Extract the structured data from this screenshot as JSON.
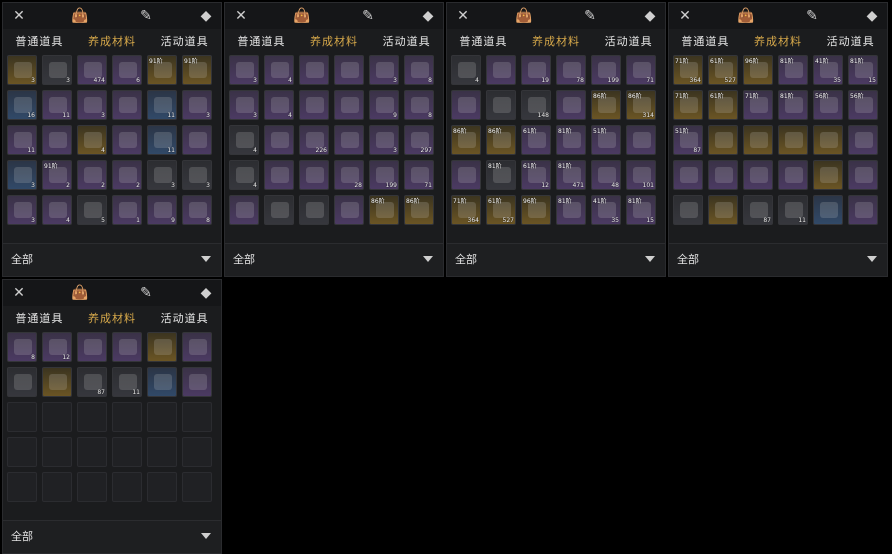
{
  "tabs": {
    "common": "普通道具",
    "materials": "养成材料",
    "event": "活动道具"
  },
  "filter": {
    "label": "全部"
  },
  "icons": {
    "swords": "crossed-swords-icon",
    "bag": "bag-icon",
    "scroll": "scroll-quill-icon",
    "gem": "gem-icon",
    "dropdown": "chevron-down-icon"
  },
  "panels": [
    {
      "cells": [
        {
          "q": "3",
          "r": "gold"
        },
        {
          "q": "3",
          "r": "gray"
        },
        {
          "q": "474",
          "r": "purple"
        },
        {
          "q": "6",
          "r": "purple"
        },
        {
          "lv": "91阶",
          "q": "",
          "r": "gold"
        },
        {
          "lv": "91阶",
          "q": "",
          "r": "gold"
        },
        {
          "q": "16",
          "r": "blue"
        },
        {
          "q": "11",
          "r": "purple"
        },
        {
          "q": "3",
          "r": "purple"
        },
        {
          "q": "",
          "r": "purple"
        },
        {
          "q": "11",
          "r": "blue"
        },
        {
          "q": "3",
          "r": "purple"
        },
        {
          "q": "11",
          "r": "purple"
        },
        {
          "q": "",
          "r": "purple"
        },
        {
          "q": "4",
          "r": "gold"
        },
        {
          "q": "",
          "r": "purple"
        },
        {
          "q": "11",
          "r": "blue"
        },
        {
          "q": "",
          "r": "purple"
        },
        {
          "q": "3",
          "r": "blue"
        },
        {
          "lv": "91阶",
          "q": "2",
          "r": "purple"
        },
        {
          "q": "2",
          "r": "purple"
        },
        {
          "q": "2",
          "r": "purple"
        },
        {
          "q": "3",
          "r": "gray"
        },
        {
          "q": "3",
          "r": "gray"
        },
        {
          "q": "3",
          "r": "purple"
        },
        {
          "q": "4",
          "r": "purple"
        },
        {
          "q": "5",
          "r": "gray"
        },
        {
          "q": "1",
          "r": "purple"
        },
        {
          "q": "9",
          "r": "purple"
        },
        {
          "q": "8",
          "r": "purple"
        }
      ]
    },
    {
      "cells": [
        {
          "q": "3",
          "r": "purple"
        },
        {
          "q": "4",
          "r": "purple"
        },
        {
          "q": "",
          "r": "purple"
        },
        {
          "q": "",
          "r": "purple"
        },
        {
          "q": "3",
          "r": "purple"
        },
        {
          "q": "8",
          "r": "purple"
        },
        {
          "q": "3",
          "r": "purple"
        },
        {
          "q": "4",
          "r": "purple"
        },
        {
          "q": "",
          "r": "purple"
        },
        {
          "q": "",
          "r": "purple"
        },
        {
          "q": "9",
          "r": "purple"
        },
        {
          "q": "8",
          "r": "purple"
        },
        {
          "q": "4",
          "r": "gray"
        },
        {
          "q": "",
          "r": "purple"
        },
        {
          "q": "226",
          "r": "purple"
        },
        {
          "q": "",
          "r": "purple"
        },
        {
          "q": "3",
          "r": "purple"
        },
        {
          "q": "297",
          "r": "purple"
        },
        {
          "q": "4",
          "r": "gray"
        },
        {
          "q": "",
          "r": "purple"
        },
        {
          "q": "",
          "r": "purple"
        },
        {
          "q": "28",
          "r": "purple"
        },
        {
          "q": "199",
          "r": "purple"
        },
        {
          "q": "71",
          "r": "purple"
        },
        {
          "q": "",
          "r": "purple"
        },
        {
          "q": "",
          "r": "gray"
        },
        {
          "q": "",
          "r": "gray"
        },
        {
          "q": "",
          "r": "purple"
        },
        {
          "lv": "86阶",
          "q": "",
          "r": "gold"
        },
        {
          "lv": "86阶",
          "q": "",
          "r": "gold"
        }
      ]
    },
    {
      "cells": [
        {
          "q": "4",
          "r": "gray"
        },
        {
          "q": "",
          "r": "purple"
        },
        {
          "q": "19",
          "r": "purple"
        },
        {
          "q": "78",
          "r": "purple"
        },
        {
          "q": "199",
          "r": "purple"
        },
        {
          "q": "71",
          "r": "purple"
        },
        {
          "q": "",
          "r": "purple"
        },
        {
          "q": "",
          "r": "gray"
        },
        {
          "q": "148",
          "r": "gray"
        },
        {
          "q": "",
          "r": "purple"
        },
        {
          "lv": "86阶",
          "q": "",
          "r": "gold"
        },
        {
          "lv": "86阶",
          "q": "314",
          "r": "gold"
        },
        {
          "lv": "86阶",
          "q": "",
          "r": "gold"
        },
        {
          "lv": "86阶",
          "q": "",
          "r": "gold"
        },
        {
          "lv": "61阶",
          "q": "",
          "r": "purple"
        },
        {
          "lv": "81阶",
          "q": "",
          "r": "purple"
        },
        {
          "lv": "51阶",
          "q": "",
          "r": "purple"
        },
        {
          "q": "",
          "r": "purple"
        },
        {
          "q": "",
          "r": "purple"
        },
        {
          "lv": "81阶",
          "q": "",
          "r": "gray"
        },
        {
          "lv": "61阶",
          "q": "12",
          "r": "purple"
        },
        {
          "lv": "81阶",
          "q": "471",
          "r": "purple"
        },
        {
          "q": "48",
          "r": "purple"
        },
        {
          "q": "101",
          "r": "purple"
        },
        {
          "lv": "71阶",
          "q": "364",
          "r": "gold"
        },
        {
          "lv": "61阶",
          "q": "527",
          "r": "gold"
        },
        {
          "lv": "96阶",
          "q": "",
          "r": "gold"
        },
        {
          "lv": "81阶",
          "q": "",
          "r": "purple"
        },
        {
          "lv": "41阶",
          "q": "35",
          "r": "purple"
        },
        {
          "lv": "81阶",
          "q": "15",
          "r": "purple"
        }
      ]
    },
    {
      "cells": [
        {
          "lv": "71阶",
          "q": "364",
          "r": "gold"
        },
        {
          "lv": "61阶",
          "q": "527",
          "r": "gold"
        },
        {
          "lv": "96阶",
          "q": "",
          "r": "gold"
        },
        {
          "lv": "81阶",
          "q": "",
          "r": "purple"
        },
        {
          "lv": "41阶",
          "q": "35",
          "r": "purple"
        },
        {
          "lv": "81阶",
          "q": "15",
          "r": "purple"
        },
        {
          "lv": "71阶",
          "q": "",
          "r": "gold"
        },
        {
          "lv": "61阶",
          "q": "",
          "r": "gold"
        },
        {
          "lv": "71阶",
          "q": "",
          "r": "purple"
        },
        {
          "lv": "81阶",
          "q": "",
          "r": "purple"
        },
        {
          "lv": "56阶",
          "q": "",
          "r": "purple"
        },
        {
          "lv": "56阶",
          "q": "",
          "r": "purple"
        },
        {
          "lv": "51阶",
          "q": "87",
          "r": "purple"
        },
        {
          "q": "",
          "r": "gold"
        },
        {
          "q": "",
          "r": "gold"
        },
        {
          "q": "",
          "r": "gold"
        },
        {
          "q": "",
          "r": "gold"
        },
        {
          "q": "",
          "r": "purple"
        },
        {
          "q": "",
          "r": "purple"
        },
        {
          "q": "",
          "r": "purple"
        },
        {
          "q": "",
          "r": "purple"
        },
        {
          "q": "",
          "r": "purple"
        },
        {
          "q": "",
          "r": "gold"
        },
        {
          "q": "",
          "r": "purple"
        },
        {
          "q": "",
          "r": "gray"
        },
        {
          "q": "",
          "r": "gold"
        },
        {
          "q": "87",
          "r": "gray"
        },
        {
          "q": "11",
          "r": "gray"
        },
        {
          "q": "",
          "r": "blue"
        },
        {
          "q": "",
          "r": "purple"
        }
      ]
    },
    {
      "cells": [
        {
          "q": "8",
          "r": "purple"
        },
        {
          "q": "12",
          "r": "purple"
        },
        {
          "q": "",
          "r": "purple"
        },
        {
          "q": "",
          "r": "purple"
        },
        {
          "q": "",
          "r": "gold"
        },
        {
          "q": "",
          "r": "purple"
        },
        {
          "q": "",
          "r": "gray"
        },
        {
          "q": "",
          "r": "gold"
        },
        {
          "q": "87",
          "r": "gray"
        },
        {
          "q": "11",
          "r": "gray"
        },
        {
          "q": "",
          "r": "blue"
        },
        {
          "q": "",
          "r": "purple"
        },
        {
          "q": "",
          "r": "empty"
        },
        {
          "q": "",
          "r": "empty"
        },
        {
          "q": "",
          "r": "empty"
        },
        {
          "q": "",
          "r": "empty"
        },
        {
          "q": "",
          "r": "empty"
        },
        {
          "q": "",
          "r": "empty"
        },
        {
          "q": "",
          "r": "empty"
        },
        {
          "q": "",
          "r": "empty"
        },
        {
          "q": "",
          "r": "empty"
        },
        {
          "q": "",
          "r": "empty"
        },
        {
          "q": "",
          "r": "empty"
        },
        {
          "q": "",
          "r": "empty"
        },
        {
          "q": "",
          "r": "empty"
        },
        {
          "q": "",
          "r": "empty"
        },
        {
          "q": "",
          "r": "empty"
        },
        {
          "q": "",
          "r": "empty"
        },
        {
          "q": "",
          "r": "empty"
        },
        {
          "q": "",
          "r": "empty"
        }
      ]
    }
  ]
}
